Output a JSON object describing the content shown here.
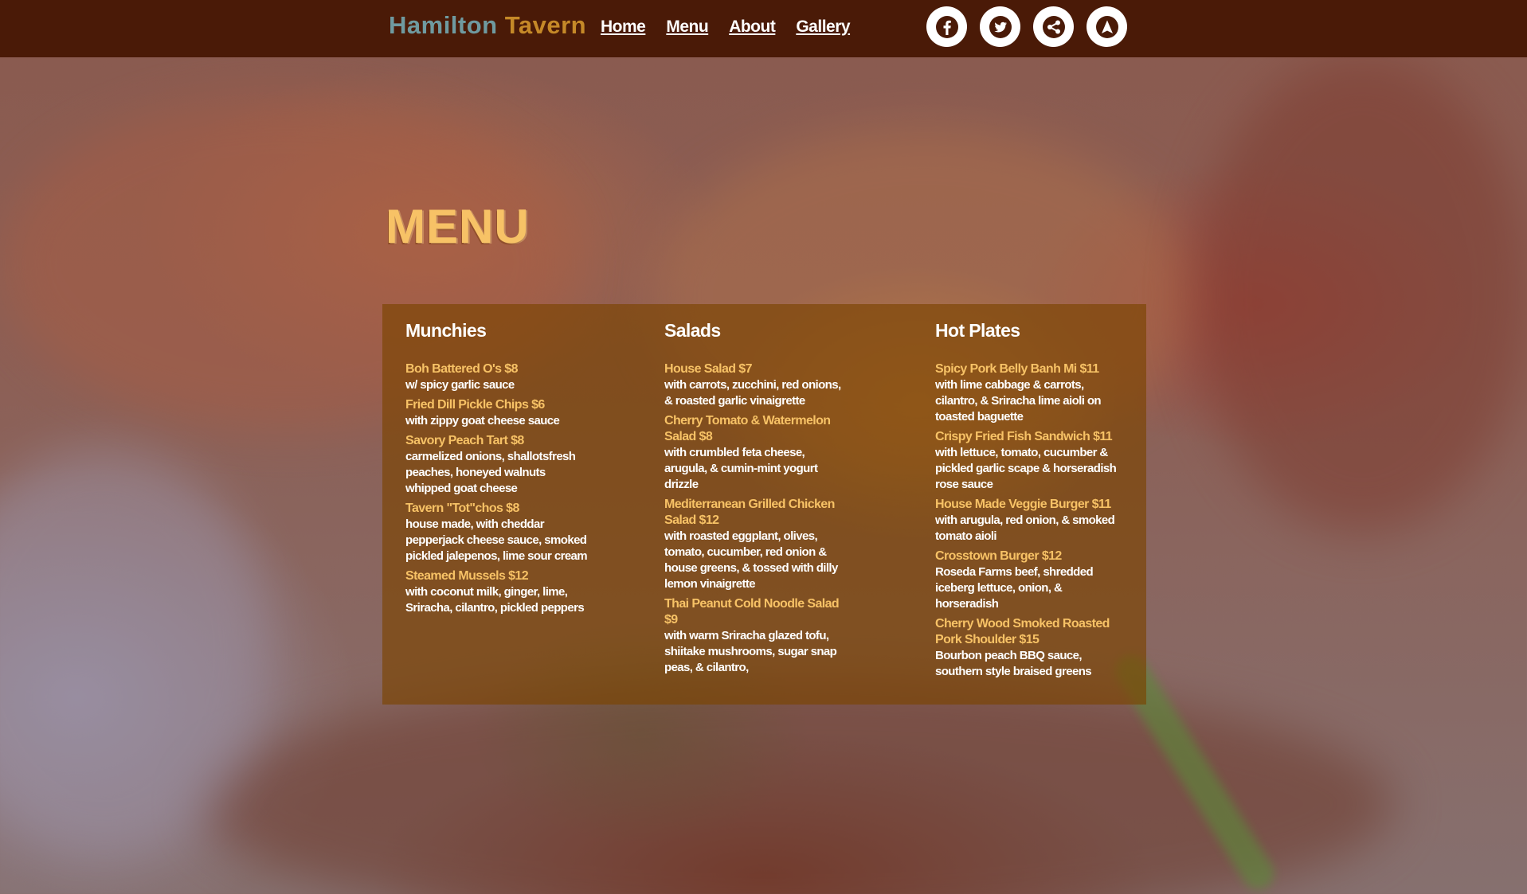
{
  "brand": {
    "word1": "Hamilton",
    "word2": "Tavern"
  },
  "nav": [
    {
      "label": "Home"
    },
    {
      "label": "Menu"
    },
    {
      "label": "About"
    },
    {
      "label": "Gallery"
    }
  ],
  "socials": [
    {
      "icon": "facebook-icon"
    },
    {
      "icon": "twitter-icon"
    },
    {
      "icon": "share-icon"
    },
    {
      "icon": "navigation-arrow-icon"
    }
  ],
  "page_title": "MENU",
  "colors": {
    "navbar": "#4a1a07",
    "accent": "#f7c266",
    "brand_blue": "#6f9aa0",
    "brand_gold": "#c58928"
  },
  "menu": {
    "columns": [
      {
        "title": "Munchies",
        "items": [
          {
            "name": "Boh Battered O's $8",
            "desc": "w/ spicy garlic sauce"
          },
          {
            "name": "Fried Dill Pickle Chips $6",
            "desc": "with zippy goat cheese sauce"
          },
          {
            "name": "Savory Peach Tart $8",
            "desc": "carmelized onions, shallotsfresh peaches, honeyed walnuts whipped goat cheese"
          },
          {
            "name": "Tavern \"Tot\"chos $8",
            "desc": "house made, with cheddar pepperjack cheese sauce, smoked pickled jalepenos, lime sour cream"
          },
          {
            "name": "Steamed Mussels $12",
            "desc": "with coconut milk, ginger, lime, Sriracha, cilantro, pickled peppers"
          }
        ]
      },
      {
        "title": "Salads",
        "items": [
          {
            "name": "House Salad $7",
            "desc": "with carrots, zucchini, red onions, & roasted garlic vinaigrette"
          },
          {
            "name": "Cherry Tomato & Watermelon Salad $8",
            "desc": "with crumbled feta cheese, arugula, & cumin-mint yogurt drizzle"
          },
          {
            "name": "Mediterranean Grilled Chicken Salad $12",
            "desc": "with roasted eggplant, olives, tomato, cucumber, red onion & house greens, & tossed with dilly lemon vinaigrette"
          },
          {
            "name": "Thai Peanut Cold Noodle Salad $9",
            "desc": "with warm Sriracha glazed tofu, shiitake mushrooms, sugar snap peas, & cilantro,"
          }
        ]
      },
      {
        "title": "Hot Plates",
        "items": [
          {
            "name": "Spicy Pork Belly Banh Mi $11",
            "desc": "with lime cabbage & carrots, cilantro, & Sriracha lime aioli on toasted baguette"
          },
          {
            "name": "Crispy Fried Fish Sandwich $11",
            "desc": "with lettuce, tomato, cucumber & pickled garlic scape & horseradish rose sauce"
          },
          {
            "name": "House Made Veggie Burger $11",
            "desc": "with arugula, red onion, & smoked tomato aioli"
          },
          {
            "name": "Crosstown Burger $12",
            "desc": "Roseda Farms beef, shredded iceberg lettuce, onion, & horseradish"
          },
          {
            "name": "Cherry Wood Smoked Roasted Pork Shoulder $15",
            "desc": "Bourbon peach BBQ sauce, southern style braised greens"
          }
        ]
      }
    ]
  }
}
